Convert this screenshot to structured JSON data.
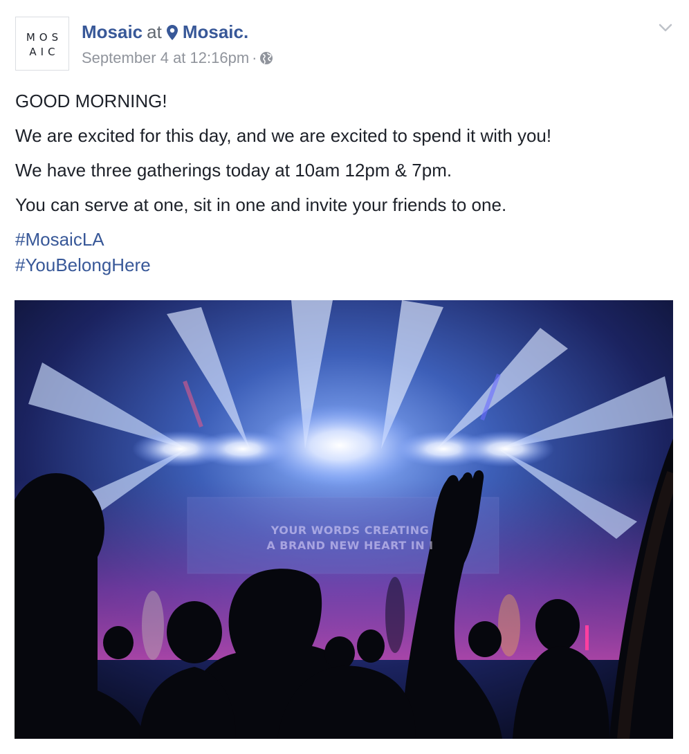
{
  "header": {
    "avatar_text_line1": "MOS",
    "avatar_text_line2": "AIC",
    "page_name": "Mosaic",
    "at_word": "at",
    "location_name": "Mosaic.",
    "timestamp": "September 4 at 12:16pm",
    "separator": "·",
    "privacy_icon": "globe-icon",
    "options_icon": "chevron-down-icon"
  },
  "post": {
    "paragraphs": [
      "GOOD MORNING!",
      "We are excited for this day, and we are excited to spend it with you!",
      "We have three gatherings today at 10am 12pm & 7pm.",
      "You can serve at one, sit in one and invite your friends to one."
    ],
    "hashtags": [
      "#MosaicLA",
      "#YouBelongHere"
    ]
  },
  "photo": {
    "screen_line1": "YOUR WORDS CREATING",
    "screen_line2": "A BRAND NEW HEART IN I"
  },
  "colors": {
    "link": "#385898",
    "meta": "#90949c",
    "text": "#1d2129"
  }
}
